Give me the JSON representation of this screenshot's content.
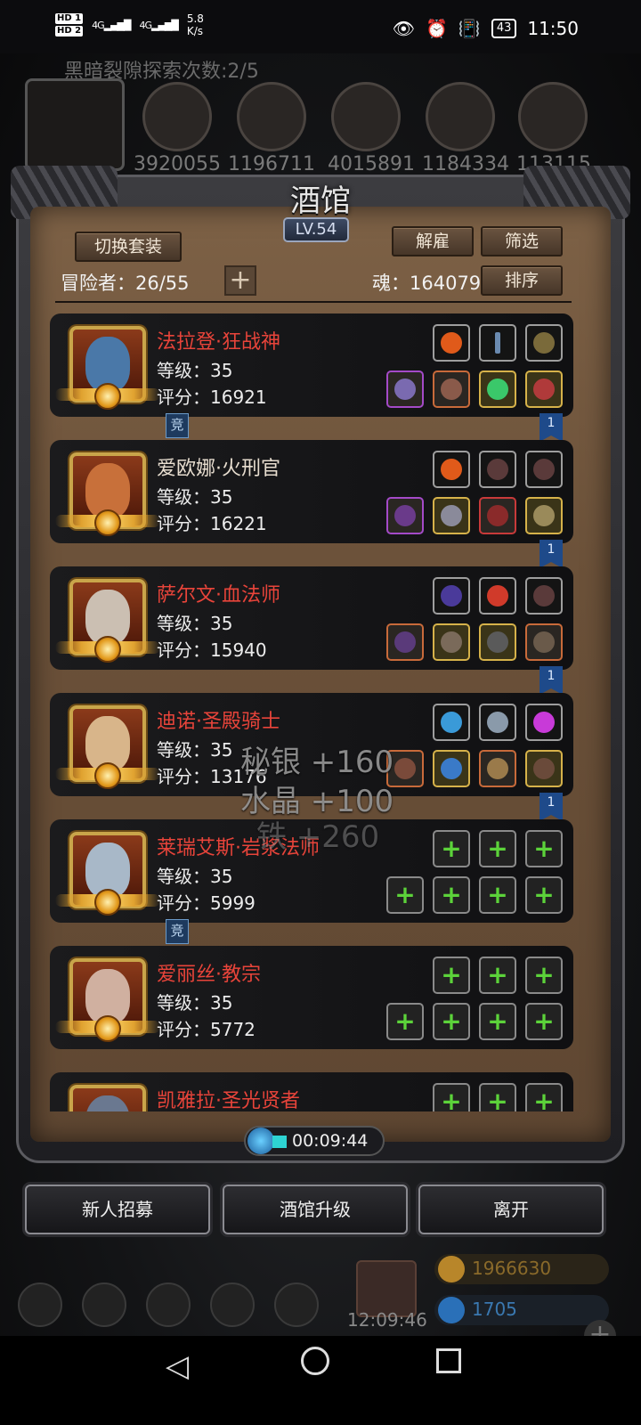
{
  "status_bar": {
    "hd1": "HD 1",
    "hd2": "HD 2",
    "signal1": "4G",
    "signal2": "4G",
    "speed_value": "5.8",
    "speed_unit": "K/s",
    "battery": "43",
    "time": "11:50"
  },
  "background": {
    "title": "黑暗裂隙探索次数:2/5",
    "resource_numbers": [
      "3920055",
      "1196711",
      "4015891",
      "1184334",
      "113115"
    ],
    "gold": "1966630",
    "gems": "1705",
    "clock": "12:09:46"
  },
  "panel": {
    "title": "酒馆",
    "level": "LV.54",
    "switch_set_label": "切换套装",
    "dismiss_label": "解雇",
    "filter_label": "筛选",
    "sort_label": "排序",
    "adventurer_count": "冒险者：26/55",
    "soul": "魂：164079"
  },
  "heroes": [
    {
      "name": "法拉登·狂战神",
      "name_color": "red",
      "level": "等级：35",
      "score": "评分：16921",
      "badge_jing": "竞",
      "bookmark": "1",
      "face": "#4a78a8"
    },
    {
      "name": "爱欧娜·火刑官",
      "name_color": "white",
      "level": "等级：35",
      "score": "评分：16221",
      "bookmark": "1",
      "face": "#c8703a"
    },
    {
      "name": "萨尔文·血法师",
      "name_color": "red",
      "level": "等级：35",
      "score": "评分：15940",
      "bookmark": "1",
      "face": "#cbbfb2"
    },
    {
      "name": "迪诺·圣殿骑士",
      "name_color": "red",
      "level": "等级：35",
      "score": "评分：13176",
      "bookmark": "1",
      "face": "#d8b58a"
    },
    {
      "name": "莱瑞艾斯·岩浆法师",
      "name_color": "red",
      "level": "等级：35",
      "score": "评分：5999",
      "badge_jing": "竞",
      "face": "#a8b8c8"
    },
    {
      "name": "爱丽丝·教宗",
      "name_color": "red",
      "level": "等级：35",
      "score": "评分：5772",
      "face": "#d0b0a0"
    },
    {
      "name": "凯雅拉·圣光贤者",
      "name_color": "red",
      "level": "",
      "score": "",
      "face": "#6a7890"
    }
  ],
  "floating_rewards": [
    "秘银 +160",
    "水晶 +100",
    "铁 +260"
  ],
  "timer": "00:09:44",
  "bottom_buttons": {
    "recruit": "新人招募",
    "upgrade": "酒馆升级",
    "leave": "离开"
  },
  "colors": {
    "name_red": "#e8443a",
    "plus_green": "#5cd33a",
    "panel_brown": "#6b5139"
  }
}
